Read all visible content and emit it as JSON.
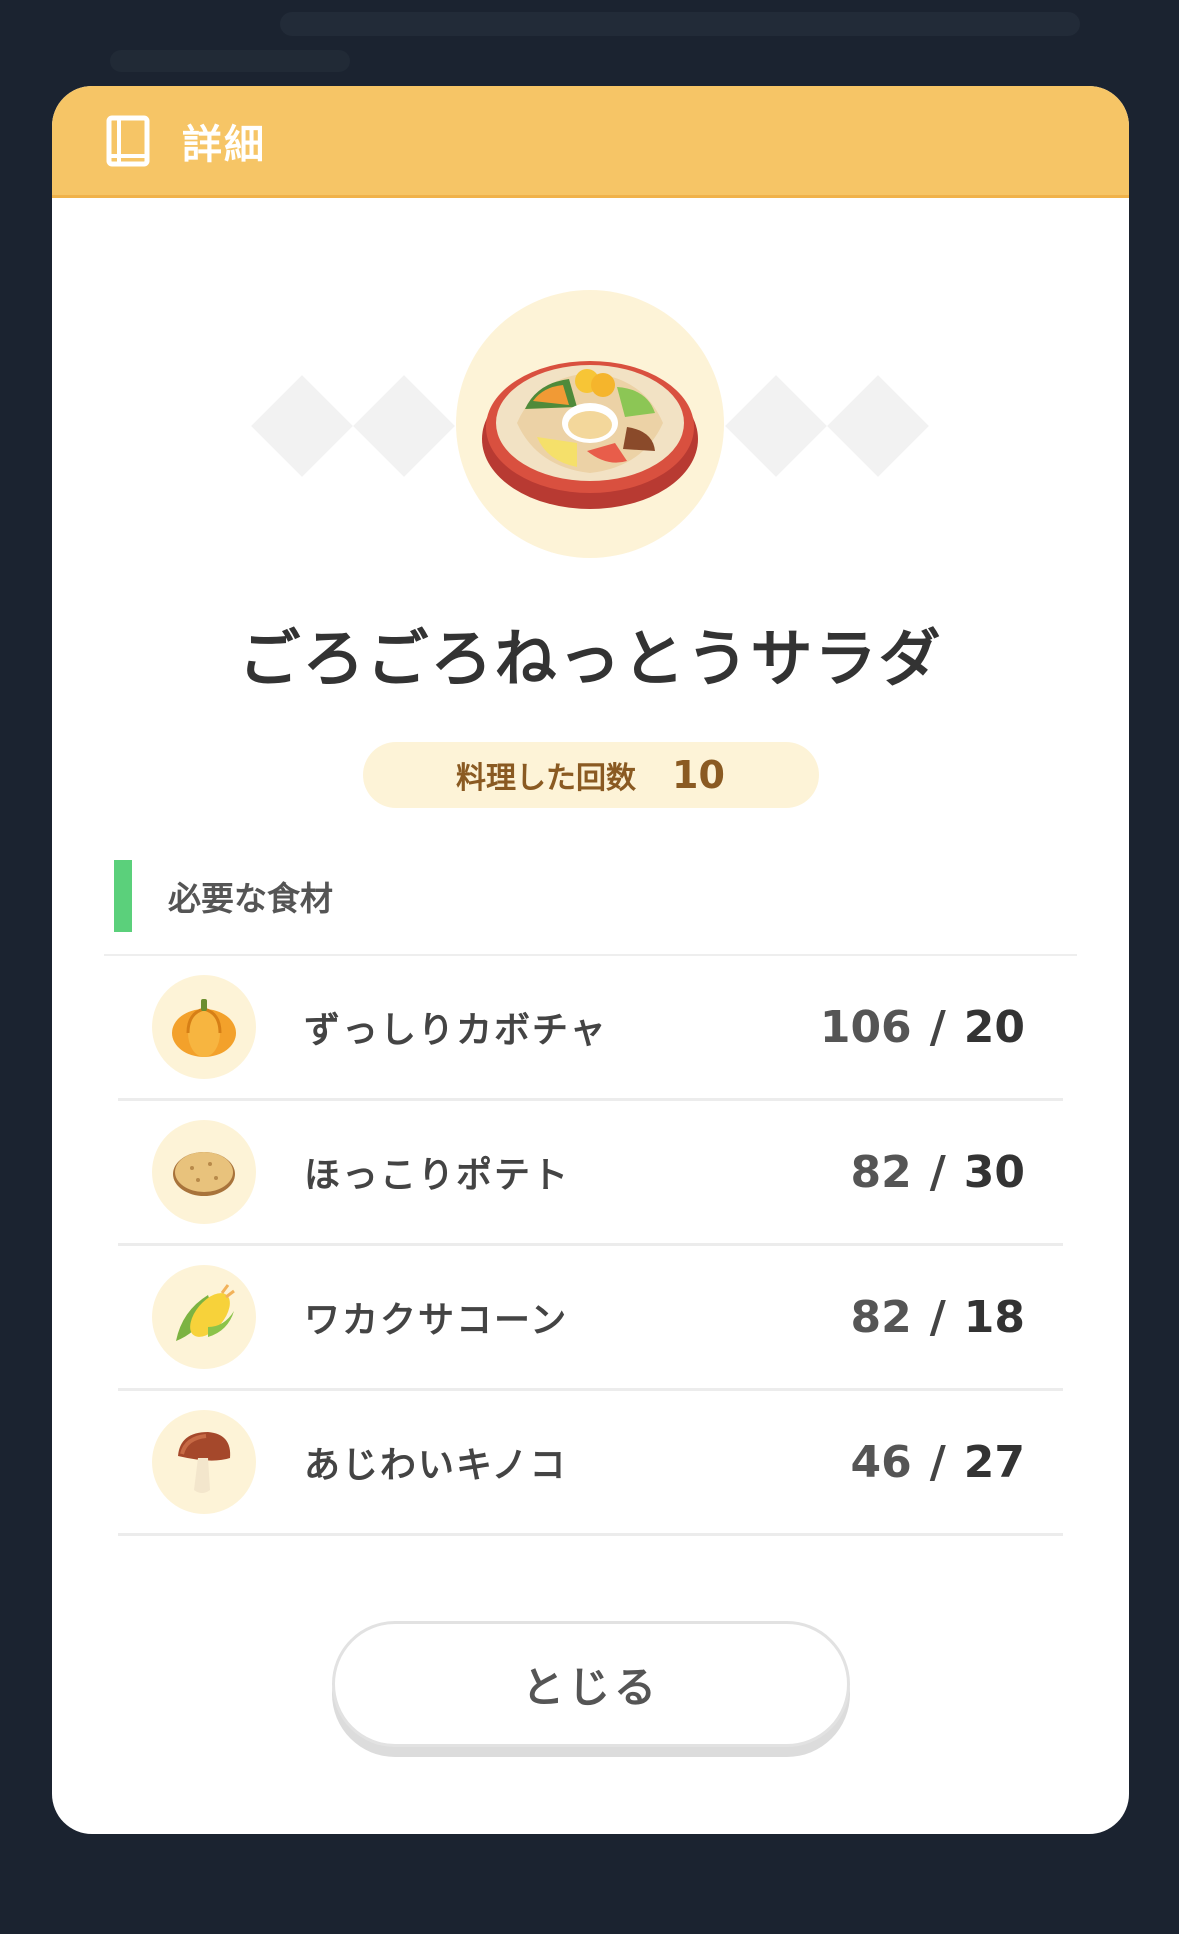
{
  "header": {
    "title": "詳細",
    "icon": "book-icon",
    "color": "#f6c566"
  },
  "dish": {
    "name": "ごろごろねっとうサラダ",
    "icon": "salad-bowl-icon"
  },
  "cook_count": {
    "label": "料理した回数",
    "value": "10"
  },
  "ingredients_section": {
    "title": "必要な食材",
    "accent": "#5bd07b",
    "items": [
      {
        "name": "ずっしりカボチャ",
        "icon": "pumpkin-icon",
        "have": "106",
        "sep": "/",
        "need": "20"
      },
      {
        "name": "ほっこりポテト",
        "icon": "potato-icon",
        "have": "82",
        "sep": "/",
        "need": "30"
      },
      {
        "name": "ワカクサコーン",
        "icon": "corn-icon",
        "have": "82",
        "sep": "/",
        "need": "18"
      },
      {
        "name": "あじわいキノコ",
        "icon": "mushroom-icon",
        "have": "46",
        "sep": "/",
        "need": "27"
      }
    ]
  },
  "close_button": {
    "label": "とじる"
  }
}
